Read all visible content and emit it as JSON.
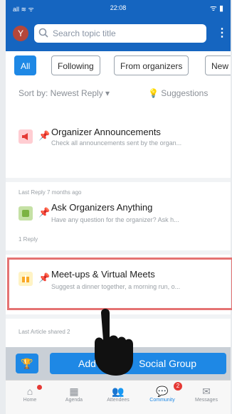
{
  "status": {
    "left": "all ≋ ᯤ",
    "time": "22:08",
    "right": "ᯤ ▮"
  },
  "header": {
    "avatar_letter": "Y",
    "search_placeholder": "Search topic title",
    "more": "⋮"
  },
  "filters": [
    {
      "label": "All",
      "active": true
    },
    {
      "label": "Following",
      "active": false
    },
    {
      "label": "From organizers",
      "active": false
    },
    {
      "label": "New",
      "active": false
    }
  ],
  "sort": {
    "label": "Sort by: Newest Reply",
    "suggestions": "Suggestions"
  },
  "items": [
    {
      "title": "Organizer Announcements",
      "desc": "Check all announcements sent by the organ...",
      "meta_top": "",
      "meta_bottom": "Last Reply 7 months ago",
      "color": "#ef5350"
    },
    {
      "title": "Ask Organizers Anything",
      "desc": "Have any question for the organizer? Ask h...",
      "meta_top": "",
      "meta_bottom": "1 Reply",
      "color": "#8bc34a"
    },
    {
      "title": "Meet-ups & Virtual Meets",
      "desc": "Suggest a dinner together, a morning run, o...",
      "meta_top": "",
      "meta_bottom": "Last Article shared 2",
      "color": "#ffd54f"
    }
  ],
  "actions": {
    "add_left": "Add",
    "add_right": "Social Group"
  },
  "tabs": [
    {
      "label": "Home",
      "active": false
    },
    {
      "label": "Agenda",
      "active": false
    },
    {
      "label": "Attendees",
      "active": false
    },
    {
      "label": "Community",
      "active": true,
      "badge": "2"
    },
    {
      "label": "Messages",
      "active": false
    }
  ],
  "colors": {
    "primary": "#1565c0",
    "accent": "#1e88e5",
    "highlight": "#e57373"
  }
}
